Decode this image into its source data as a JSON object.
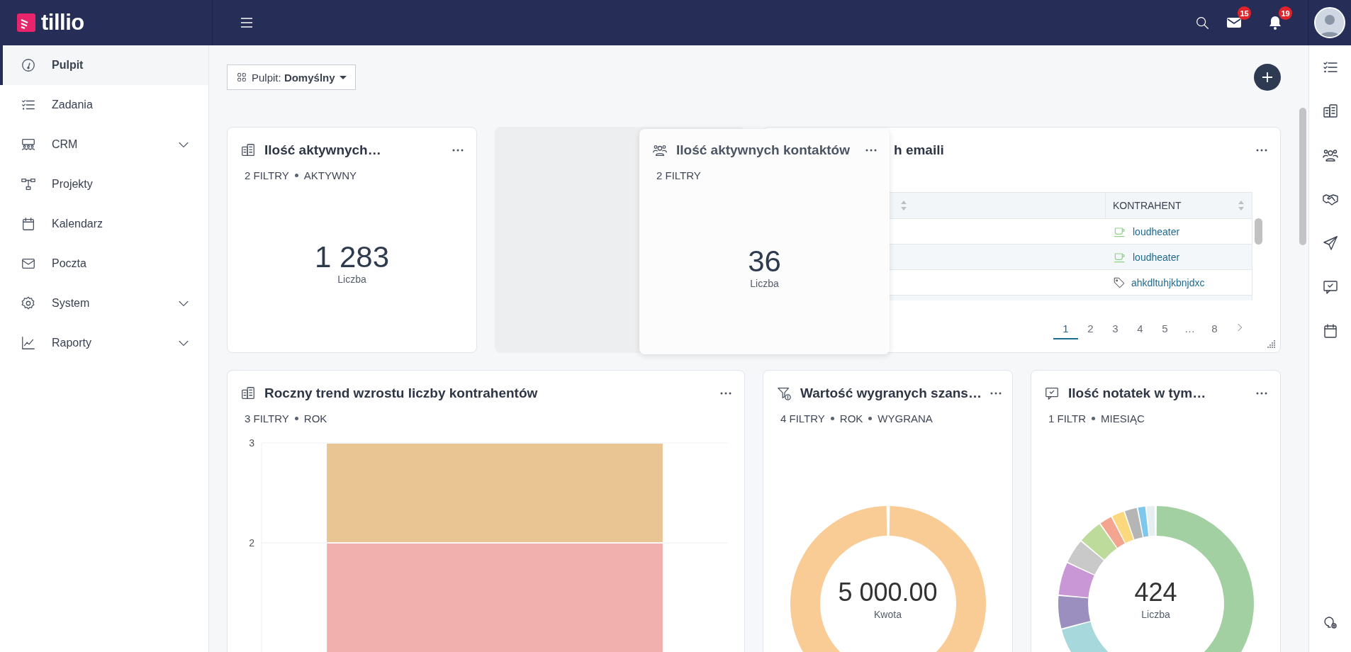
{
  "logo": {
    "text": "tillio"
  },
  "topbar": {
    "mail_count": "15",
    "notification_count": "19"
  },
  "sidebar": {
    "items": [
      {
        "label": "Pulpit",
        "selected": true
      },
      {
        "label": "Zadania",
        "selected": false
      },
      {
        "label": "CRM",
        "selected": false,
        "expanded": false
      },
      {
        "label": "Projekty",
        "selected": false
      },
      {
        "label": "Kalendarz",
        "selected": false
      },
      {
        "label": "Poczta",
        "selected": false
      },
      {
        "label": "System",
        "selected": false,
        "expanded": false
      },
      {
        "label": "Raporty",
        "selected": false,
        "expanded": false
      }
    ]
  },
  "dashboard_selector": {
    "label": "Pulpit:",
    "value": "Domyślny"
  },
  "widgets": [
    {
      "kind": "number",
      "title": "Ilość aktywnych…",
      "tags": [
        "2 FILTRY",
        "AKTYWNY"
      ],
      "value": "1 283",
      "caption": "Liczba"
    },
    {
      "kind": "placeholder"
    },
    {
      "kind": "table",
      "title": "h emaili",
      "columns": [
        "KONTRAHENT"
      ],
      "rows": [
        {
          "kind": "cup",
          "contractor": "loudheater"
        },
        {
          "kind": "cup",
          "contractor": "loudheater"
        },
        {
          "kind": "tag",
          "contractor": "ahkdltuhjkbnjdxc"
        }
      ],
      "pages": [
        {
          "label": "1",
          "selected": true
        },
        {
          "label": "2",
          "selected": false
        },
        {
          "label": "3",
          "selected": false
        },
        {
          "label": "4",
          "selected": false
        },
        {
          "label": "5",
          "selected": false
        },
        {
          "label": "…",
          "selected": false
        },
        {
          "label": "8",
          "selected": false
        }
      ]
    },
    {
      "kind": "bar",
      "title": "Roczny trend wzrostu liczby kontrahentów",
      "tags": [
        "3 FILTRY",
        "ROK"
      ],
      "chart_data": {
        "type": "bar",
        "stacked": true,
        "ylim": [
          0,
          3
        ],
        "yticks": [
          2,
          3
        ],
        "series": [
          {
            "color": "#f1b0ae",
            "values": [
              2
            ]
          },
          {
            "color": "#e8c593",
            "values": [
              1
            ]
          }
        ]
      }
    },
    {
      "kind": "ring",
      "title": "Wartość wygranych szans…",
      "tags": [
        "4 FILTRY",
        "ROK",
        "WYGRANA"
      ],
      "value": "5 000.00",
      "caption": "Kwota"
    },
    {
      "kind": "donut",
      "title": "Ilość notatek w tym…",
      "tags": [
        "1 FILTR",
        "MIESIĄC"
      ],
      "value": "424",
      "caption": "Liczba"
    }
  ],
  "dragged_widget": {
    "title": "Ilość aktywnych kontaktów",
    "tags": [
      "2 FILTRY"
    ],
    "value": "36",
    "caption": "Liczba"
  }
}
